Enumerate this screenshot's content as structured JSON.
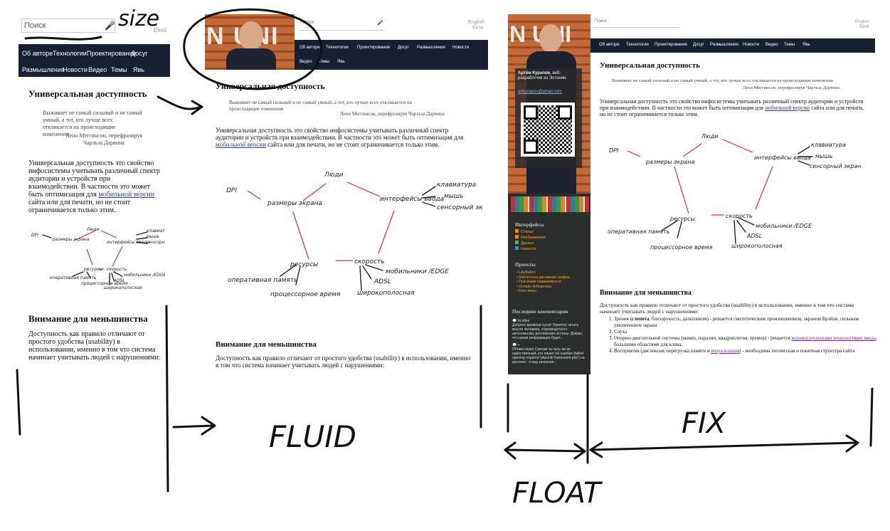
{
  "search_placeholder": "Поиск",
  "lang_english": "English",
  "lang_eesti": "Eesti",
  "nav_items": [
    "Об авторе",
    "Технологии",
    "Проектирование",
    "Досуг",
    "Размышления",
    "Новости",
    "Видео",
    "Темы",
    "Явь"
  ],
  "logo_letters": "N UNI",
  "title": "Универсальная доступность",
  "quote_text": "Выживает не самый сильный и не самый умный, а тот, кто лучше всех откликается на происходящие изменения",
  "quote_author": "Леон Меггинсон, перефразируя Чарльза Дарвина",
  "quote_text_narrow": "Выживает не самый сильный и не самый умный, а тот, кто лучше всех откликается на происходящие изменения",
  "quote_author_narrow_1": "Леон Меггинсон, перефразируя",
  "quote_author_narrow_2": "Чарльза Дарвина",
  "paragraph_1_start": "Универсальная доступность это свойство инфосистемы учитывать различный спектр аудитории и устройств при взаимодействии. В частности это может быть оптимизация для",
  "paragraph_1_link": "мобильной версии",
  "paragraph_1_end": "сайта или для печати, но не стоит ограничивается только этим.",
  "diagram": {
    "people": "Люди",
    "dpi": "DPI",
    "screen_size": "размеры экрана",
    "input_interfaces": "интерфейсы ввода",
    "keyboard": "клавиатура",
    "mouse": "мышь",
    "touch_screen": "сенсорный экран",
    "resource": "ресурсы",
    "speed": "скорость",
    "ram": "оперативная память",
    "cpu_time": "процессорное время",
    "mobile_edge": "мобильники /EDGE",
    "adsl": "ADSL",
    "broadband": "широкополосная"
  },
  "heading_minority": "Внимание для меньшинства",
  "paragraph_2": "Доступность как правило отличают от простого удобства (usability) в использовании, именно в том что система начинает учитывать людей с нарушениями:",
  "list_items": [
    {
      "pre": "Зрения (",
      "bold": "слепота",
      "post": ", близорукость, дальтонизм) - решается синтетическим произношением, экраном Брэйля, сильным увеличением экрана"
    },
    {
      "pre": "Слуха",
      "bold": "",
      "post": ""
    },
    {
      "pre": "Опорно-двигательной системы (вывих, паралич, квадриплегия, тремор) - решается ",
      "link": "вспомогательными технологиями ввода",
      "post": ", большими областями для клика."
    },
    {
      "pre": "Восприятия (дислексия, перегрузка памяти и ",
      "link": "визуализация",
      "post": ") - необходима логическая и понятная структура сайта"
    }
  ],
  "profile": {
    "name": "Артём Курапов",
    "desc": ", веб-разработчик из Эстонии.",
    "email": "artkurapov@gmail.com"
  },
  "sidebar": {
    "interfaces_title": "Интерфейсы",
    "interfaces": [
      "Статьи",
      "Изображения",
      "Друзья",
      "Новости"
    ],
    "projects_title": "Проекты",
    "projects": [
      "LikeButton",
      "Библиотека рисования графов",
      "Поисковик недвижимости",
      "Онлайн библиотека",
      "Блог жены"
    ],
    "comments_title": "Последние комментарии",
    "comment_1_author": "Аслбек",
    "comment_1_text": "Доброго времени суток! Приятно читать мысли человека, стремящегося к автономному достижению истины. Думаю, что некая информация будет...",
    "comment_2_author": "+",
    "comment_2_text": "ПРивествую) Смотри ты чуть ли не единственный, кто пишет об ошибке (failed opening required 'phpunit/ framework.php') на русском - я ищу решение..."
  },
  "annotations": {
    "size": "size",
    "fluid": "FLUID",
    "fix": "FIX",
    "float": "FLOAT"
  },
  "colors": {
    "nav_bg": "#162031",
    "sidebar_bg": "#2c2e2d",
    "link": "#1b3fd6",
    "diagram_lines": "#d33333",
    "ink": "#111111"
  }
}
